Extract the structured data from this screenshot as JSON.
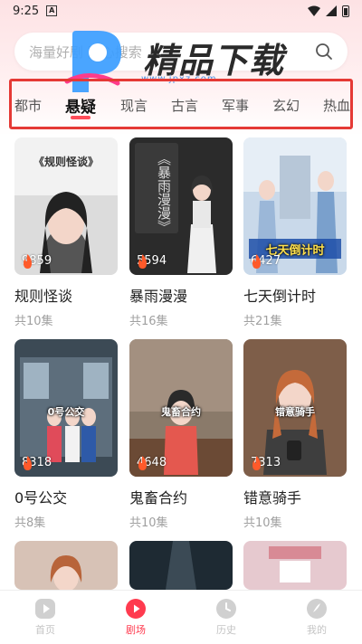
{
  "status_bar": {
    "time": "9:25",
    "notif_letter": "A"
  },
  "search": {
    "placeholder": "海量好剧 随心搜索"
  },
  "watermark": {
    "title": "精品下载",
    "url": "www.jpxz.com"
  },
  "tabs": [
    {
      "label": "都市",
      "active": false
    },
    {
      "label": "悬疑",
      "active": true
    },
    {
      "label": "现言",
      "active": false
    },
    {
      "label": "古言",
      "active": false
    },
    {
      "label": "军事",
      "active": false
    },
    {
      "label": "玄幻",
      "active": false
    },
    {
      "label": "热血",
      "active": false
    }
  ],
  "dramas": [
    {
      "title": "规则怪谈",
      "episodes": "共10集",
      "views": "9859",
      "cover_text": "《规则怪谈》"
    },
    {
      "title": "暴雨漫漫",
      "episodes": "共16集",
      "views": "5594",
      "cover_text": "《暴雨漫漫》"
    },
    {
      "title": "七天倒计时",
      "episodes": "共21集",
      "views": "6427",
      "cover_text": "七天倒计时"
    },
    {
      "title": "0号公交",
      "episodes": "共8集",
      "views": "8318",
      "cover_text": "0号公交"
    },
    {
      "title": "鬼畜合约",
      "episodes": "共10集",
      "views": "4648",
      "cover_text": "鬼畜合约"
    },
    {
      "title": "错意骑手",
      "episodes": "共10集",
      "views": "7313",
      "cover_text": "错意骑手"
    }
  ],
  "bottom_nav": [
    {
      "label": "首页",
      "icon": "play-icon",
      "active": false
    },
    {
      "label": "剧场",
      "icon": "theater-icon",
      "active": true
    },
    {
      "label": "历史",
      "icon": "clock-icon",
      "active": false
    },
    {
      "label": "我的",
      "icon": "profile-icon",
      "active": false
    }
  ],
  "colors": {
    "accent": "#ff3b4f",
    "highlight_box": "#e53935",
    "header_bg": "#fde2e4"
  }
}
